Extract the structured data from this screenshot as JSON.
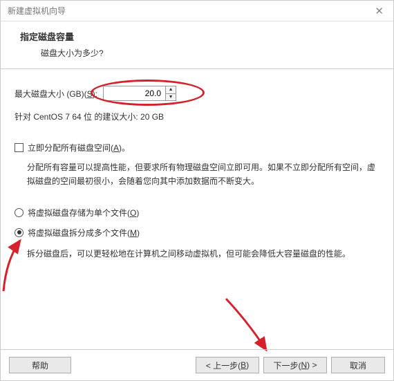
{
  "titlebar": {
    "title": "新建虚拟机向导"
  },
  "header": {
    "title": "指定磁盘容量",
    "subtitle": "磁盘大小为多少?"
  },
  "size": {
    "label_prefix": "最大磁盘大小 (GB)(",
    "label_key": "S",
    "label_suffix": "):",
    "value": "20.0"
  },
  "recommend": "针对 CentOS 7 64 位 的建议大小: 20 GB",
  "allocate": {
    "label_prefix": "立即分配所有磁盘空间(",
    "label_key": "A",
    "label_suffix": ")。",
    "desc": "分配所有容量可以提高性能，但要求所有物理磁盘空间立即可用。如果不立即分配所有空间，虚拟磁盘的空间最初很小，会随着您向其中添加数据而不断变大。"
  },
  "radios": {
    "single": {
      "label_prefix": "将虚拟磁盘存储为单个文件(",
      "label_key": "O",
      "label_suffix": ")"
    },
    "multi": {
      "label_prefix": "将虚拟磁盘拆分成多个文件(",
      "label_key": "M",
      "label_suffix": ")",
      "desc": "拆分磁盘后，可以更轻松地在计算机之间移动虚拟机，但可能会降低大容量磁盘的性能。"
    }
  },
  "buttons": {
    "help": "帮助",
    "back_prefix": "< 上一步(",
    "back_key": "B",
    "back_suffix": ")",
    "next_prefix": "下一步(",
    "next_key": "N",
    "next_suffix": ") >",
    "cancel": "取消"
  }
}
